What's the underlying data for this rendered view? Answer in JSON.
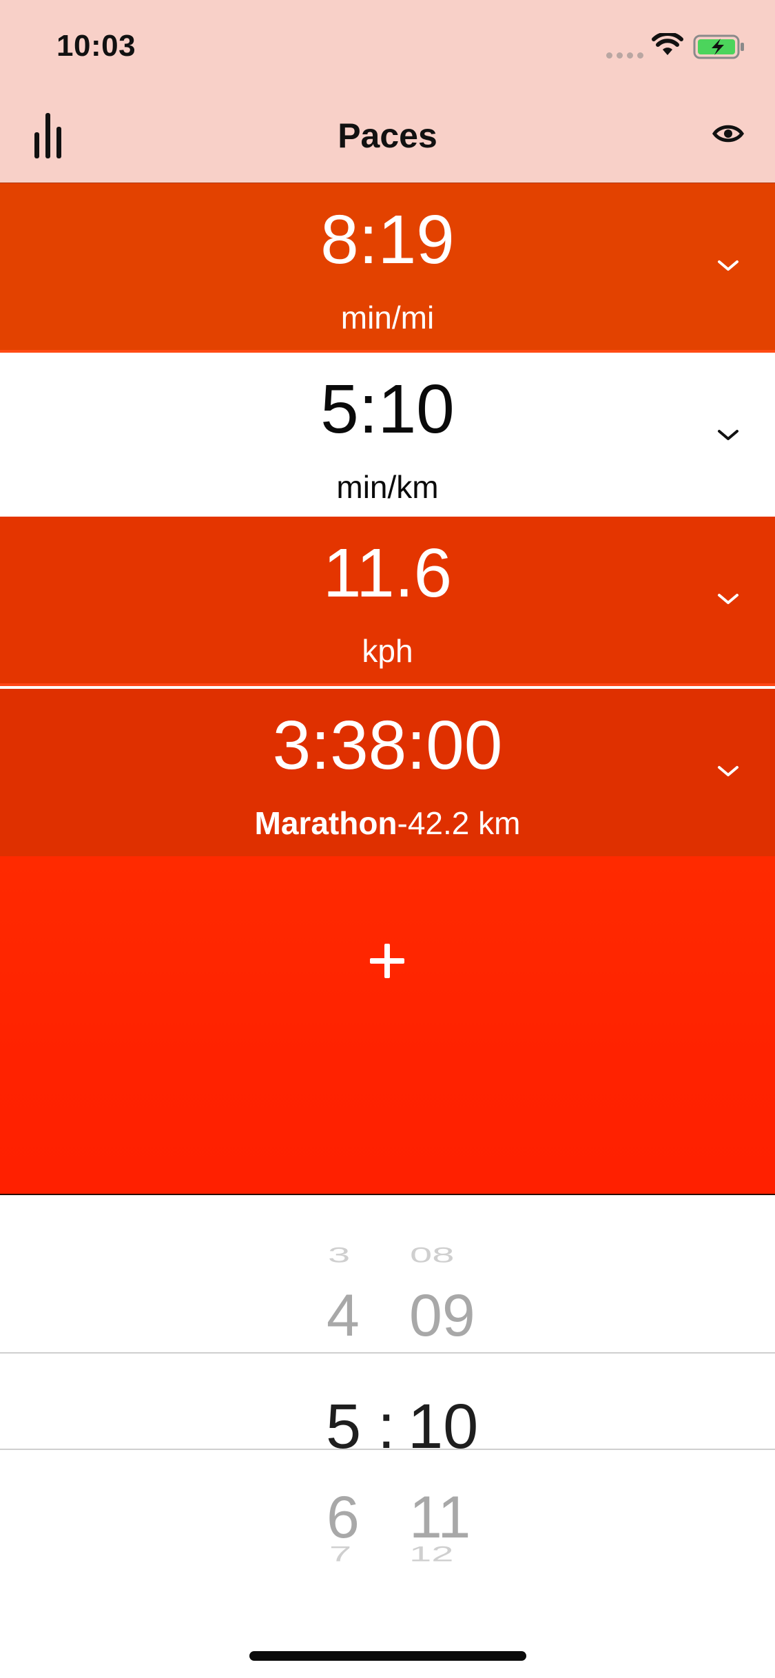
{
  "status_bar": {
    "time": "10:03"
  },
  "nav": {
    "title": "Paces"
  },
  "rows": [
    {
      "value": "8:19",
      "unit": "min/mi"
    },
    {
      "value": "5:10",
      "unit": "min/km"
    },
    {
      "value": "11.6",
      "unit": "kph"
    },
    {
      "value": "3:38:00",
      "unit_bold": "Marathon",
      "unit": "-42.2 km"
    }
  ],
  "add_label": "+",
  "picker": {
    "minutes": [
      "3",
      "4",
      "5",
      "6",
      "7"
    ],
    "seconds": [
      "08",
      "09",
      "10",
      "11",
      "12"
    ],
    "separator": ":"
  },
  "colors": {
    "header_bg": "#f8d0c8",
    "row_mi": "#e34200",
    "row_kph": "#e43500",
    "row_marathon": "#df3000",
    "add_area": "#ff2a00"
  }
}
